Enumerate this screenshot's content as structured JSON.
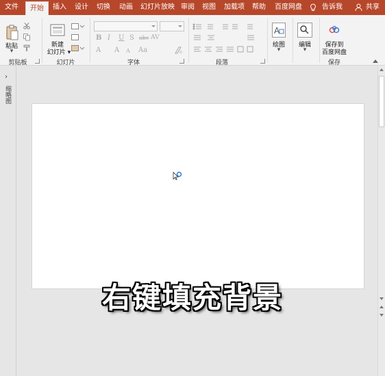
{
  "tabs": [
    {
      "label": "文件"
    },
    {
      "label": "开始"
    },
    {
      "label": "插入"
    },
    {
      "label": "设计"
    },
    {
      "label": "切换"
    },
    {
      "label": "动画"
    },
    {
      "label": "幻灯片放映"
    },
    {
      "label": "审阅"
    },
    {
      "label": "视图"
    },
    {
      "label": "加载项"
    },
    {
      "label": "帮助"
    },
    {
      "label": "百度网盘"
    }
  ],
  "tell_me": "告诉我",
  "share": "共享",
  "ribbon": {
    "clipboard": {
      "paste": "粘贴",
      "group": "剪贴板"
    },
    "slides": {
      "new_line1": "新建",
      "new_line2": "幻灯片",
      "group": "幻灯片"
    },
    "font": {
      "group": "字体",
      "glyphs": [
        "B",
        "I",
        "U",
        "S",
        "abc",
        "AV",
        "A",
        "A",
        "A",
        "Aa"
      ]
    },
    "paragraph": {
      "group": "段落"
    },
    "drawing": {
      "label": "绘图"
    },
    "editing": {
      "label": "编辑"
    },
    "save": {
      "line1": "保存到",
      "line2": "百度网盘",
      "group": "保存"
    }
  },
  "thumbpane": {
    "label": "缩略图"
  },
  "caption": "右键填充背景",
  "colors": {
    "accent": "#b7472a",
    "ribbon_bg": "#f3f3f3",
    "canvas_bg": "#e6e6e6"
  }
}
